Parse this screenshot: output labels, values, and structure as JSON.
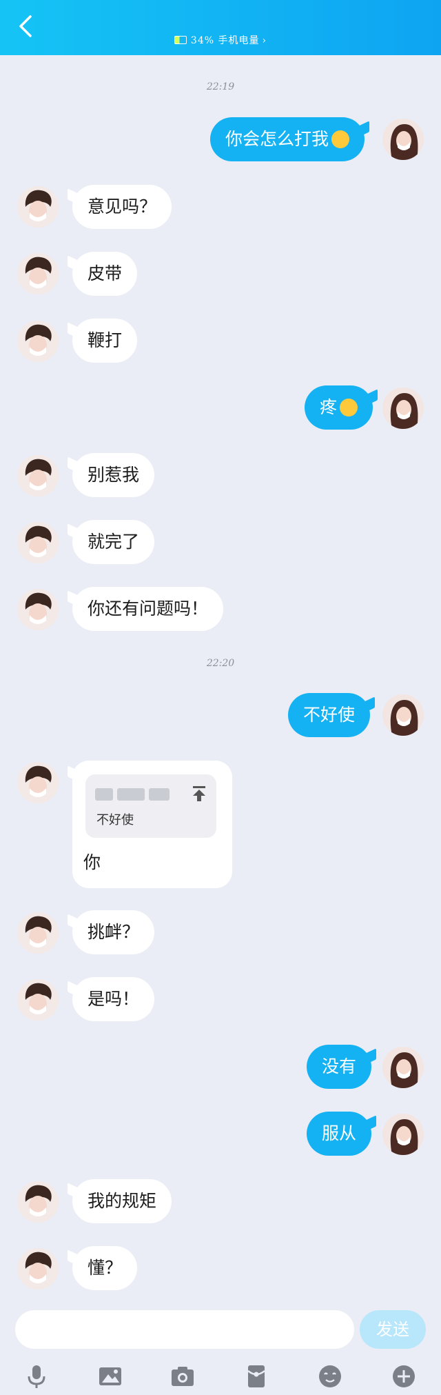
{
  "header": {
    "battery_text": "34% 手机电量",
    "chevron": "›"
  },
  "timestamps": [
    "22:19",
    "22:20"
  ],
  "messages": [
    {
      "text": "你会怎么打我"
    },
    {
      "text": "意见吗？"
    },
    {
      "text": "皮带"
    },
    {
      "text": "鞭打"
    },
    {
      "text": "疼"
    },
    {
      "text": "别惹我"
    },
    {
      "text": "就完了"
    },
    {
      "text": "你还有问题吗！"
    },
    {
      "text": "不好使"
    },
    {
      "quote": "不好使",
      "text": "你"
    },
    {
      "text": "挑衅？"
    },
    {
      "text": "是吗！"
    },
    {
      "text": "没有"
    },
    {
      "text": "服从"
    },
    {
      "text": "我的规矩"
    },
    {
      "text": "懂？"
    }
  ],
  "input": {
    "send_label": "发送"
  },
  "icons": [
    "back-icon",
    "microphone-icon",
    "image-icon",
    "camera-icon",
    "red-packet-icon",
    "emoji-icon",
    "plus-icon"
  ],
  "colors": {
    "header": "#0ea4f2",
    "out_bubble": "#14b2f2",
    "in_bubble": "#ffffff",
    "background": "#eaedf5"
  }
}
